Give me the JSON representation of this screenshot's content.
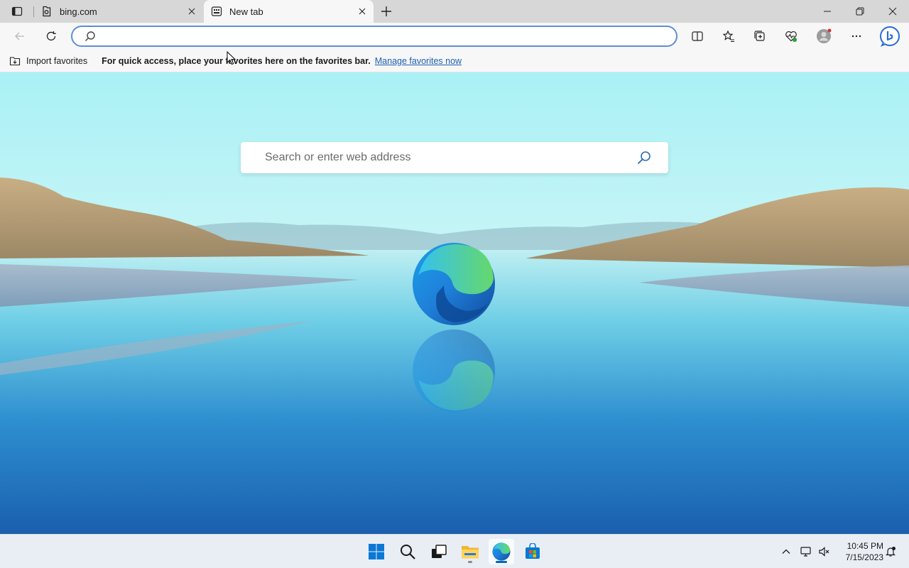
{
  "tabs": [
    {
      "title": "bing.com",
      "favicon": "bing-favicon-icon",
      "active": false
    },
    {
      "title": "New tab",
      "favicon": "newtab-favicon-icon",
      "active": true
    }
  ],
  "address_bar": {
    "value": "",
    "placeholder": ""
  },
  "favorites_bar": {
    "import_label": "Import favorites",
    "hint": "For quick access, place your favorites here on the favorites bar.",
    "manage_link": "Manage favorites now"
  },
  "ntp": {
    "search_placeholder": "Search or enter web address"
  },
  "taskbar": {
    "time": "10:45 PM",
    "date": "7/15/2023"
  },
  "colors": {
    "accent": "#0067c0",
    "link": "#1c5fb3"
  }
}
